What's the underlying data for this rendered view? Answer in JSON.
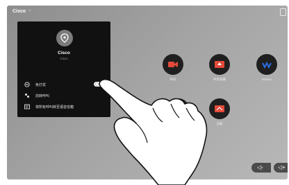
{
  "topbar": {
    "title": "Cisco",
    "caret": "›"
  },
  "panel": {
    "name": "Cisco",
    "subtitle": "Cisco",
    "rows": [
      {
        "icon": "minus-circle-icon",
        "label": "免打扰"
      },
      {
        "icon": "people-icon",
        "label": "前转呼叫"
      },
      {
        "icon": "message-icon",
        "label": "将所有呼叫转至语音信箱"
      }
    ]
  },
  "background_buttons": [
    {
      "icon": "video-icon",
      "label": "呼叫"
    },
    {
      "icon": "share-screen-icon",
      "label": "共享屏幕"
    },
    {
      "icon": "webex-icon",
      "label": "Webex"
    },
    {
      "icon": "whiteboard-icon",
      "label": "白板"
    }
  ],
  "controls": {
    "volume_down": "◁-",
    "volume_up": "◁+"
  },
  "colors": {
    "panel_bg": "#111111",
    "screen_bg": "#9e9e9e",
    "button_bg": "#1f1f1f",
    "webex_blue": "#2b6de3"
  }
}
